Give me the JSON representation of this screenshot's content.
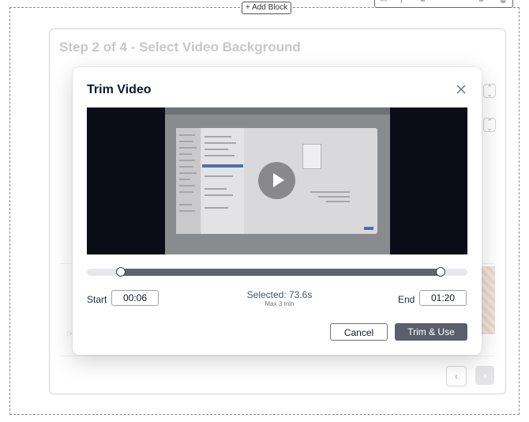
{
  "editor": {
    "add_block_label": "+ Add Block"
  },
  "wizard": {
    "step_title": "Step 2 of 4 - Select Video Background"
  },
  "modal": {
    "title": "Trim Video",
    "start_label": "Start",
    "start_value": "00:06",
    "end_label": "End",
    "end_value": "01:20",
    "selected_text": "Selected: 73.6s",
    "max_text": "Max 3 min",
    "trim_range_fraction": {
      "start": 0.09,
      "end": 0.93
    },
    "cancel_label": "Cancel",
    "trim_label": "Trim & Use"
  },
  "colors": {
    "primary_button": "#5b5f6b",
    "video_background": "#0b0c16",
    "track_range": "#60646f"
  },
  "icons": {
    "close": "close-icon",
    "play": "play-icon",
    "prev": "chevron-left-icon",
    "next": "chevron-right-icon"
  }
}
